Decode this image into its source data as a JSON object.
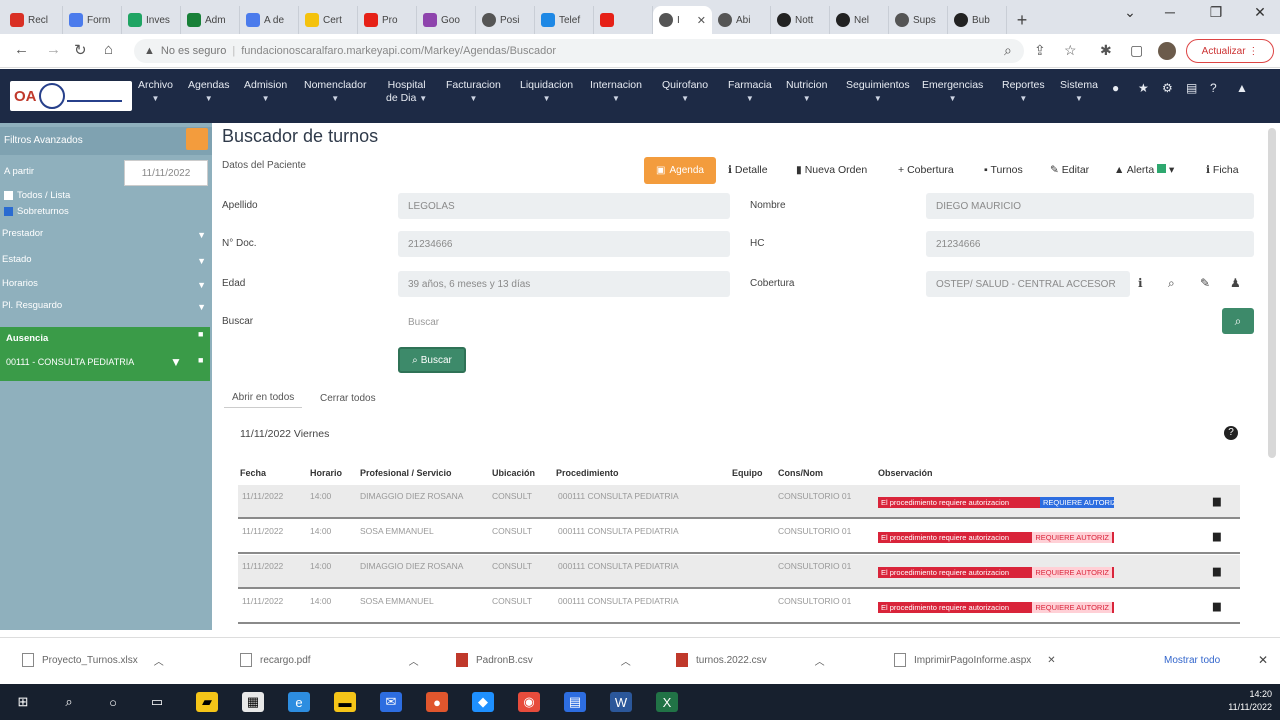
{
  "browser": {
    "tabs": [
      {
        "label": "Recl",
        "color": "#d93025"
      },
      {
        "label": "Form",
        "color": "#4b7bec"
      },
      {
        "label": "Inves",
        "color": "#1fa463"
      },
      {
        "label": "Adm",
        "color": "#188038"
      },
      {
        "label": "A de",
        "color": "#4b7bec"
      },
      {
        "label": "Cert",
        "color": "#f4c20d"
      },
      {
        "label": "Pro",
        "color": "#e62117"
      },
      {
        "label": "Goo",
        "color": "#8e44ad"
      },
      {
        "label": "Posi",
        "color": "#555"
      },
      {
        "label": "Telef",
        "color": "#1e88e5"
      },
      {
        "label": "",
        "color": "#e62117"
      },
      {
        "label": "I",
        "color": "#555",
        "active": true
      },
      {
        "label": "Abi",
        "color": "#555"
      },
      {
        "label": "Nott",
        "color": "#222"
      },
      {
        "label": "Nel",
        "color": "#222"
      },
      {
        "label": "Sups",
        "color": "#555"
      },
      {
        "label": "Bub",
        "color": "#222"
      }
    ],
    "url_security": "No es seguro",
    "url": "fundacionoscaralfaro.markeyapi.com/Markey/Agendas/Buscador",
    "update_label": "Actualizar"
  },
  "app": {
    "logo_text": "OA",
    "menu": [
      {
        "label": "Archivo",
        "sub": ""
      },
      {
        "label": "Agendas",
        "sub": ""
      },
      {
        "label": "Admision",
        "sub": ""
      },
      {
        "label": "Nomenclador",
        "sub": ""
      },
      {
        "label": "Hospital",
        "sub": "de Dia"
      },
      {
        "label": "Facturacion",
        "sub": ""
      },
      {
        "label": "Liquidacion",
        "sub": ""
      },
      {
        "label": "Internacion",
        "sub": ""
      },
      {
        "label": "Quirofano",
        "sub": ""
      },
      {
        "label": "Farmacia",
        "sub": ""
      },
      {
        "label": "Nutricion",
        "sub": ""
      },
      {
        "label": "Seguimientos",
        "sub": ""
      },
      {
        "label": "Emergencias",
        "sub": ""
      },
      {
        "label": "Reportes",
        "sub": ""
      },
      {
        "label": "Sistema",
        "sub": ""
      }
    ]
  },
  "sidebar": {
    "header": "Filtros Avanzados",
    "date_label": "A partir",
    "date_value": "11/11/2022",
    "check1": "Todos / Lista",
    "check2": "Sobreturnos",
    "selects": [
      "Prestador",
      "Estado",
      "Horarios",
      "Pl. Resguardo"
    ],
    "green_title": "Ausencia",
    "green_value": "00111 - CONSULTA PEDIATRIA"
  },
  "main": {
    "title": "Buscador de turnos",
    "patient_label": "Datos del Paciente",
    "orange_btn": "Agenda",
    "actions": [
      "Detalle",
      "Nueva Orden",
      "Cobertura",
      "Turnos",
      "Editar",
      "Alerta",
      "Ficha"
    ],
    "fields": {
      "apellido_label": "Apellido",
      "apellido_value": "LEGOLAS",
      "nombre_label": "Nombre",
      "nombre_value": "DIEGO MAURICIO",
      "ndoc_label": "N° Doc.",
      "ndoc_value": "21234666",
      "hc_label": "HC",
      "hc_value": "21234666",
      "edad_label": "Edad",
      "edad_value": "39 años, 6 meses y 13 días",
      "cobertura_label": "Cobertura",
      "cobertura_value": "OSTEP/ SALUD - CENTRAL ACCESOR",
      "buscar_label": "Buscar",
      "buscar_placeholder": "Buscar"
    },
    "search_btn": "Buscar",
    "tab_open": "Abrir en todos",
    "tab_close": "Cerrar todos",
    "date_row": "11/11/2022 Viernes",
    "columns": [
      "Fecha",
      "Horario",
      "Profesional / Servicio",
      "Ubicación",
      "Procedimiento",
      "Equipo",
      "Cons/Nom",
      "Observación"
    ],
    "rows": [
      {
        "fecha": "11/11/2022",
        "horario": "14:00",
        "prof": "DIMAGGIO DIEZ ROSANA",
        "ubic": "CONSULT",
        "proc": "000111 CONSULTA PEDIATRIA",
        "cons": "CONSULTORIO 01",
        "obs": "El procedimiento requiere autorizacion",
        "obs_hl": "REQUIERE AUTORIZ"
      },
      {
        "fecha": "11/11/2022",
        "horario": "14:00",
        "prof": "SOSA EMMANUEL",
        "ubic": "CONSULT",
        "proc": "000111 CONSULTA PEDIATRIA",
        "cons": "CONSULTORIO 01",
        "obs": "El procedimiento requiere autorizacion",
        "obs_hl": "REQUIERE AUTORIZ"
      },
      {
        "fecha": "11/11/2022",
        "horario": "14:00",
        "prof": "DIMAGGIO DIEZ ROSANA",
        "ubic": "CONSULT",
        "proc": "000111 CONSULTA PEDIATRIA",
        "cons": "CONSULTORIO 01",
        "obs": "El procedimiento requiere autorizacion",
        "obs_hl": "REQUIERE AUTORIZ"
      },
      {
        "fecha": "11/11/2022",
        "horario": "14:00",
        "prof": "SOSA EMMANUEL",
        "ubic": "CONSULT",
        "proc": "000111 CONSULTA PEDIATRIA",
        "cons": "CONSULTORIO 01",
        "obs": "El procedimiento requiere autorizacion",
        "obs_hl": "REQUIERE AUTORIZ"
      }
    ]
  },
  "downloads": [
    {
      "name": "Proyecto_Turnos.xlsx"
    },
    {
      "name": "recargo.pdf"
    },
    {
      "name": "PadronB.csv"
    },
    {
      "name": "turnos.2022.csv"
    },
    {
      "name": "ImprimirPagoInforme.aspx"
    }
  ],
  "downloads_show_all": "Mostrar todo",
  "clock": {
    "time": "14:20",
    "date": "11/11/2022"
  }
}
